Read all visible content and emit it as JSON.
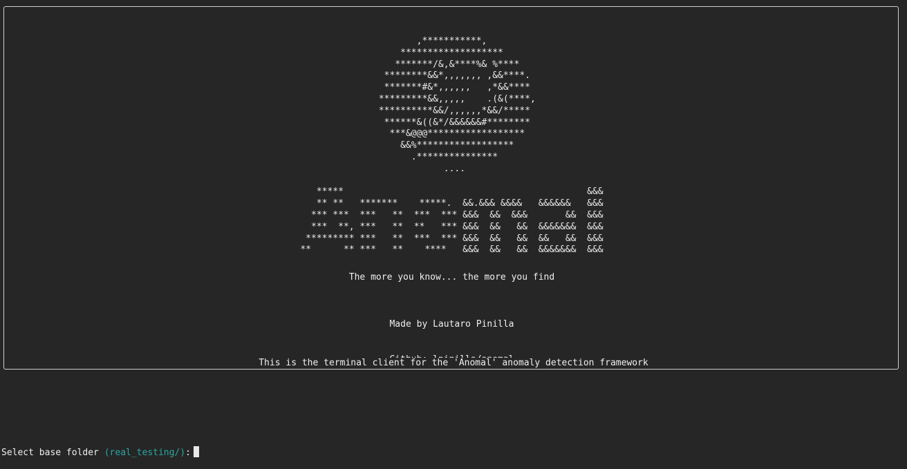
{
  "banner": {
    "ascii_art": [
      "          ,***********,          ",
      "       *******************       ",
      "      *******/&,&****%& %****    ",
      "    ********&&*,,,,,,, ,&&****.  ",
      "    *******#&*,,,,,,   ,*&&****  ",
      "   *********&&,,,,,    .(&(****, ",
      "   **********&&/,,,,,,*&&/*****  ",
      "    ******&((&*/&&&&&&#********  ",
      "     ***&@@@******************   ",
      "       &&%******************     ",
      "         .***************        ",
      "               ....              ",
      "",
      "   *****                                             &&&",
      "   ** **   *******    *****.  &&.&&& &&&&   &&&&&&   &&&",
      "  *** ***  ***   **  ***  *** &&&  &&  &&&       &&  &&&",
      "  ***  **, ***   **  **   *** &&&  &&   &&  &&&&&&&  &&&",
      " ********* ***   **  ***  *** &&&  &&   &&  &&   &&  &&&",
      "**      ** ***   **    ****   &&&  &&   &&  &&&&&&&  &&&"
    ],
    "tagline": "The more you know... the more you find",
    "made_by": "Made by Lautaro Pinilla",
    "github": "Github: lpinilla/anomal"
  },
  "panel_subtitle": "This is the terminal client for the 'Anomal' anomaly detection framework",
  "prompt": {
    "label": "Select base folder",
    "default_value": "(real_testing/)",
    "suffix": ":"
  }
}
